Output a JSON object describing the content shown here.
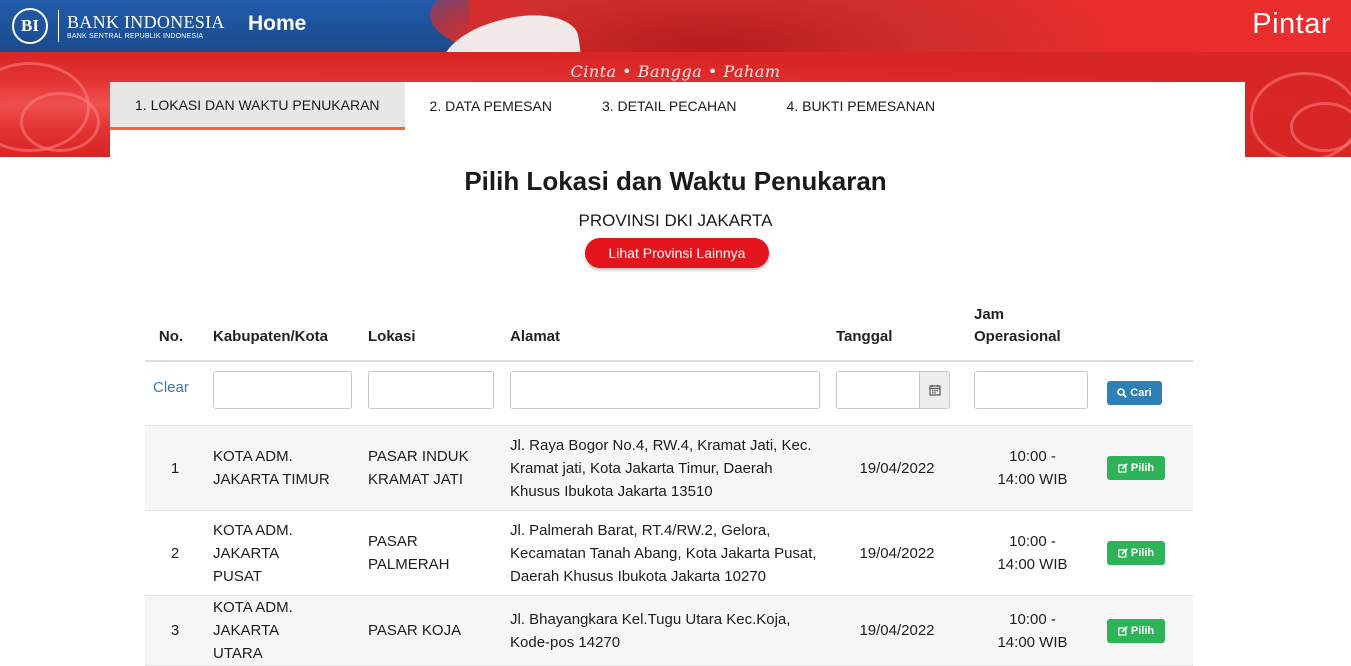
{
  "header": {
    "logo_badge": "BI",
    "brand_name": "BANK INDONESIA",
    "brand_sub": "BANK SENTRAL REPUBLIK INDONESIA",
    "home_label": "Home",
    "app_name": "Pintar",
    "colors": {
      "blue": "#1f5aa3",
      "red": "#e22a2a"
    }
  },
  "banner": {
    "tagline": "Cinta • Bangga • Paham"
  },
  "steps": [
    {
      "label": "1. LOKASI DAN WAKTU PENUKARAN",
      "active": true
    },
    {
      "label": "2. DATA PEMESAN",
      "active": false
    },
    {
      "label": "3. DETAIL PECAHAN",
      "active": false
    },
    {
      "label": "4. BUKTI PEMESANAN",
      "active": false
    }
  ],
  "main": {
    "title": "Pilih Lokasi dan Waktu Penukaran",
    "province": "PROVINSI DKI JAKARTA",
    "other_province_button": "Lihat Provinsi Lainnya"
  },
  "table": {
    "headers": {
      "no": "No.",
      "kota": "Kabupaten/Kota",
      "lokasi": "Lokasi",
      "alamat": "Alamat",
      "tanggal": "Tanggal",
      "jam_line1": "Jam",
      "jam_line2": "Operasional"
    },
    "filters": {
      "clear_label": "Clear",
      "kota_value": "",
      "lokasi_value": "",
      "alamat_value": "",
      "tanggal_value": "",
      "jam_value": "",
      "search_button": "Cari",
      "search_icon": "search-icon",
      "calendar_icon": "calendar-icon"
    },
    "rows": [
      {
        "no": "1",
        "kota": "KOTA ADM. JAKARTA TIMUR",
        "lokasi": "PASAR INDUK KRAMAT JATI",
        "alamat": "Jl. Raya Bogor No.4, RW.4, Kramat Jati, Kec. Kramat jati, Kota Jakarta Timur, Daerah Khusus Ibukota Jakarta 13510",
        "tanggal": "19/04/2022",
        "jam": "10:00 - 14:00 WIB",
        "action": "Pilih"
      },
      {
        "no": "2",
        "kota": "KOTA ADM. JAKARTA PUSAT",
        "lokasi": "PASAR PALMERAH",
        "alamat": "Jl. Palmerah Barat, RT.4/RW.2, Gelora, Kecamatan Tanah Abang, Kota Jakarta Pusat, Daerah Khusus Ibukota Jakarta 10270",
        "tanggal": "19/04/2022",
        "jam": "10:00 - 14:00 WIB",
        "action": "Pilih"
      },
      {
        "no": "3",
        "kota": "KOTA ADM. JAKARTA UTARA",
        "lokasi": "PASAR KOJA",
        "alamat": "Jl. Bhayangkara Kel.Tugu Utara Kec.Koja, Kode-pos 14270",
        "tanggal": "19/04/2022",
        "jam": "10:00 - 14:00 WIB",
        "action": "Pilih"
      }
    ]
  }
}
